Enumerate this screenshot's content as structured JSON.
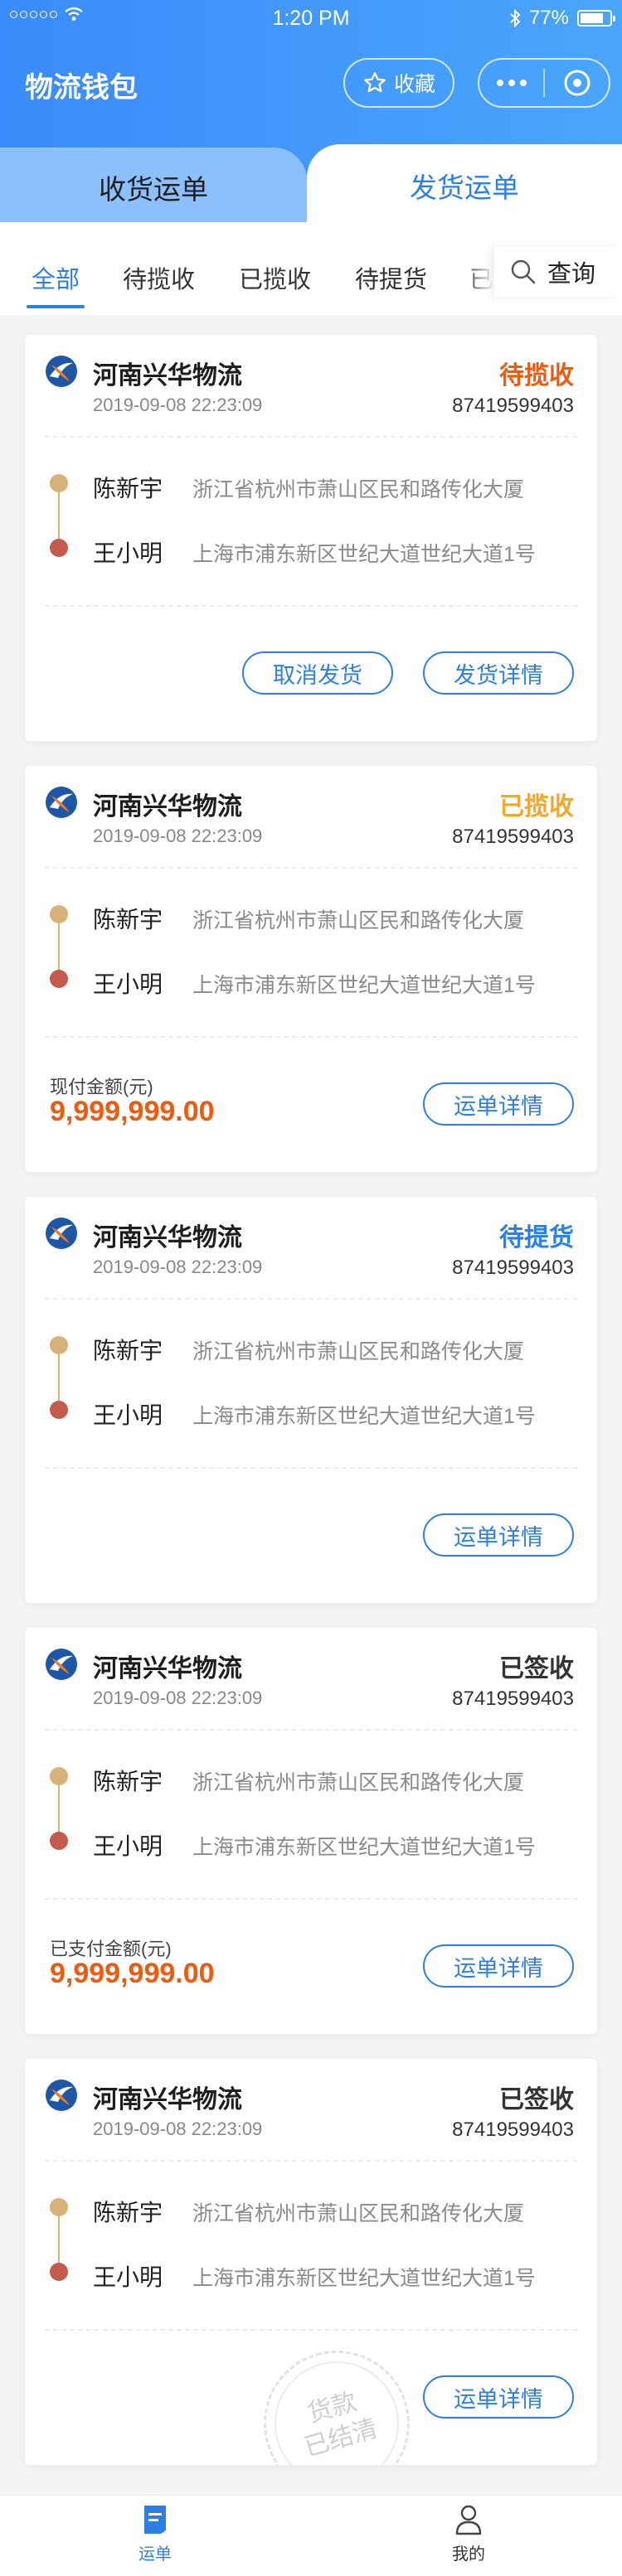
{
  "statusbar": {
    "carrier_dots": "○○○○○",
    "time": "1:20 PM",
    "battery": "77%",
    "battery_level": 0.77
  },
  "header": {
    "title": "物流钱包",
    "favorite_label": "收藏"
  },
  "tabs": {
    "receive": "收货运单",
    "send": "发货运单"
  },
  "filters": [
    "全部",
    "待揽收",
    "已揽收",
    "待提货",
    "已"
  ],
  "query_label": "查询",
  "colors": {
    "accent": "#2d7fe8",
    "orange_status": "#f05a0e",
    "amber_status": "#f5a623",
    "amount": "#f05a0e"
  },
  "cards": [
    {
      "company": "河南兴华物流",
      "time": "2019-09-08 22:23:09",
      "status": "待揽收",
      "tracking": "87419599403",
      "from_name": "陈新宇",
      "from_addr": "浙江省杭州市萧山区民和路传化大厦",
      "to_name": "王小明",
      "to_addr": "上海市浦东新区世纪大道世纪大道1号",
      "btn_cancel": "取消发货",
      "btn_detail": "发货详情"
    },
    {
      "company": "河南兴华物流",
      "time": "2019-09-08 22:23:09",
      "status": "已揽收",
      "tracking": "87419599403",
      "from_name": "陈新宇",
      "from_addr": "浙江省杭州市萧山区民和路传化大厦",
      "to_name": "王小明",
      "to_addr": "上海市浦东新区世纪大道世纪大道1号",
      "amount_label": "现付金额(元)",
      "amount": "9,999,999.00",
      "btn_detail": "运单详情"
    },
    {
      "company": "河南兴华物流",
      "time": "2019-09-08 22:23:09",
      "status": "待提货",
      "tracking": "87419599403",
      "from_name": "陈新宇",
      "from_addr": "浙江省杭州市萧山区民和路传化大厦",
      "to_name": "王小明",
      "to_addr": "上海市浦东新区世纪大道世纪大道1号",
      "btn_detail": "运单详情"
    },
    {
      "company": "河南兴华物流",
      "time": "2019-09-08 22:23:09",
      "status": "已签收",
      "tracking": "87419599403",
      "from_name": "陈新宇",
      "from_addr": "浙江省杭州市萧山区民和路传化大厦",
      "to_name": "王小明",
      "to_addr": "上海市浦东新区世纪大道世纪大道1号",
      "amount_label": "已支付金额(元)",
      "amount": "9,999,999.00",
      "btn_detail": "运单详情"
    },
    {
      "company": "河南兴华物流",
      "time": "2019-09-08 22:23:09",
      "status": "已签收",
      "tracking": "87419599403",
      "from_name": "陈新宇",
      "from_addr": "浙江省杭州市萧山区民和路传化大厦",
      "to_name": "王小明",
      "to_addr": "上海市浦东新区世纪大道世纪大道1号",
      "stamp_line1": "货款",
      "stamp_line2": "已结清",
      "btn_detail": "运单详情"
    }
  ],
  "tabbar": {
    "orders": "运单",
    "mine": "我的"
  }
}
